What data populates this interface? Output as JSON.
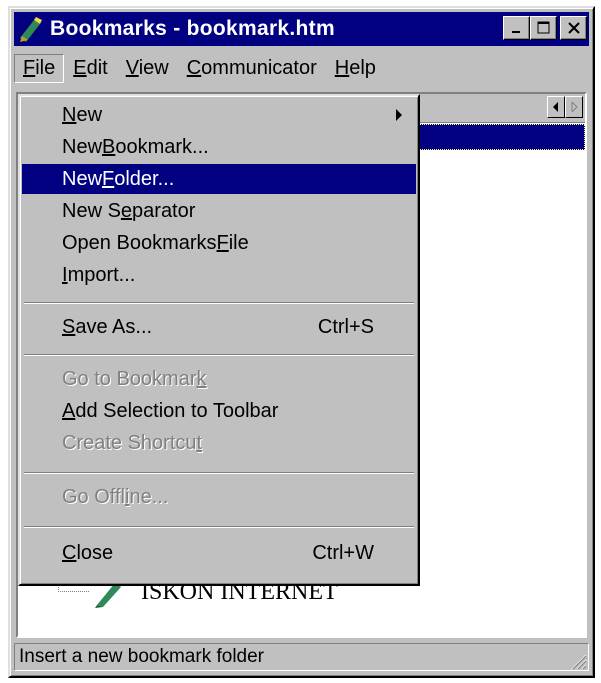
{
  "window": {
    "title": "Bookmarks - bookmark.htm"
  },
  "menubar": {
    "items": [
      {
        "label_pre": "",
        "label_key": "F",
        "label_post": "ile"
      },
      {
        "label_pre": "",
        "label_key": "E",
        "label_post": "dit"
      },
      {
        "label_pre": "",
        "label_key": "V",
        "label_post": "iew"
      },
      {
        "label_pre": "",
        "label_key": "C",
        "label_post": "ommunicator"
      },
      {
        "label_pre": "",
        "label_key": "H",
        "label_post": "elp"
      }
    ]
  },
  "file_menu": {
    "new": {
      "pre": "",
      "key": "N",
      "post": "ew"
    },
    "new_bookmark": {
      "pre": "New ",
      "key": "B",
      "post": "ookmark..."
    },
    "new_folder": {
      "pre": "New ",
      "key": "F",
      "post": "older..."
    },
    "new_separator": {
      "pre": "New S",
      "key": "e",
      "post": "parator"
    },
    "open_bookmarks": {
      "pre": "Open Bookmarks ",
      "key": "F",
      "post": "ile"
    },
    "import": {
      "pre": "",
      "key": "I",
      "post": "mport..."
    },
    "save_as": {
      "pre": "",
      "key": "S",
      "post": "ave As...",
      "shortcut": "Ctrl+S"
    },
    "go_to_bookmark": {
      "pre": "Go to Bookmar",
      "key": "k",
      "post": ""
    },
    "add_selection": {
      "pre": "",
      "key": "A",
      "post": "dd Selection to Toolbar"
    },
    "create_shortcut": {
      "pre": "Create Shortcu",
      "key": "t",
      "post": ""
    },
    "go_offline": {
      "pre": "Go Offl",
      "key": "i",
      "post": "ne..."
    },
    "close": {
      "pre": "",
      "key": "C",
      "post": "lose",
      "shortcut": "Ctrl+W"
    }
  },
  "tree": {
    "item_label": "ISKON INTERNET"
  },
  "statusbar": {
    "text": "Insert a new bookmark folder"
  }
}
